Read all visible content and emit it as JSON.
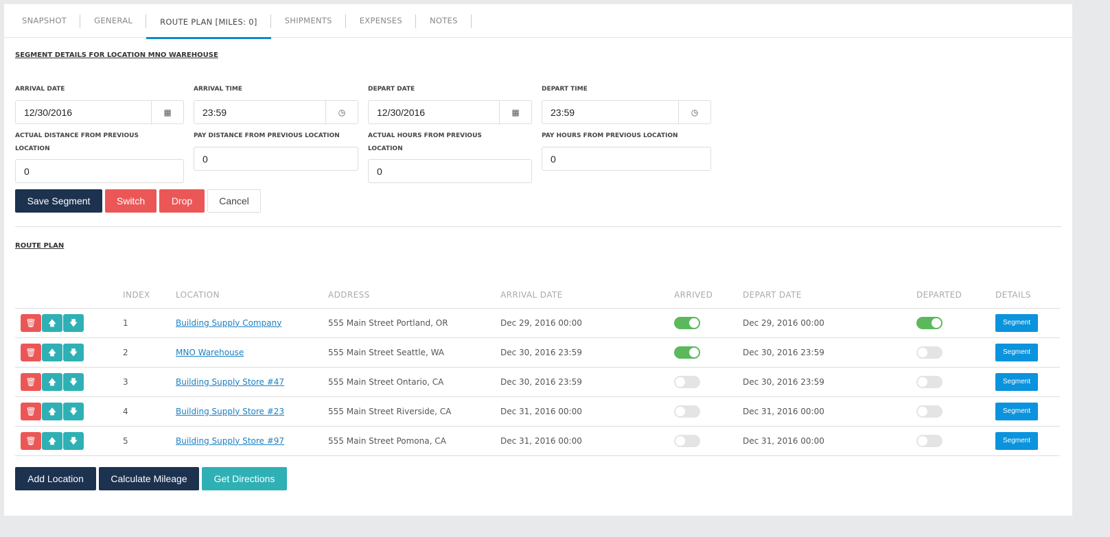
{
  "tabs": [
    "SNAPSHOT",
    "GENERAL",
    "ROUTE PLAN [MILES: 0]",
    "SHIPMENTS",
    "EXPENSES",
    "NOTES"
  ],
  "segment": {
    "heading": "SEGMENT DETAILS FOR LOCATION MNO WAREHOUSE",
    "arrival_date_label": "ARRIVAL DATE",
    "arrival_date": "12/30/2016",
    "arrival_time_label": "ARRIVAL TIME",
    "arrival_time": "23:59",
    "depart_date_label": "DEPART DATE",
    "depart_date": "12/30/2016",
    "depart_time_label": "DEPART TIME",
    "depart_time": "23:59",
    "actual_distance_label": "ACTUAL DISTANCE FROM PREVIOUS LOCATION",
    "actual_distance": "0",
    "pay_distance_label": "PAY DISTANCE FROM PREVIOUS LOCATION",
    "pay_distance": "0",
    "actual_hours_label": "ACTUAL HOURS FROM PREVIOUS LOCATION",
    "actual_hours": "0",
    "pay_hours_label": "PAY HOURS FROM PREVIOUS LOCATION",
    "pay_hours": "0",
    "save": "Save Segment",
    "switch": "Switch",
    "drop": "Drop",
    "cancel": "Cancel"
  },
  "route": {
    "heading": "ROUTE PLAN",
    "columns": [
      "INDEX",
      "LOCATION",
      "ADDRESS",
      "ARRIVAL DATE",
      "ARRIVED",
      "DEPART DATE",
      "DEPARTED",
      "DETAILS"
    ],
    "rows": [
      {
        "index": "1",
        "location": "Building Supply Company",
        "address": "555 Main Street Portland, OR",
        "arrival": "Dec 29, 2016 00:00",
        "arrived": true,
        "depart": "Dec 29, 2016 00:00",
        "departed": true,
        "details": "Segment"
      },
      {
        "index": "2",
        "location": "MNO Warehouse",
        "address": "555 Main Street Seattle, WA",
        "arrival": "Dec 30, 2016 23:59",
        "arrived": true,
        "depart": "Dec 30, 2016 23:59",
        "departed": false,
        "details": "Segment"
      },
      {
        "index": "3",
        "location": "Building Supply Store #47",
        "address": "555 Main Street Ontario, CA",
        "arrival": "Dec 30, 2016 23:59",
        "arrived": false,
        "depart": "Dec 30, 2016 23:59",
        "departed": false,
        "details": "Segment"
      },
      {
        "index": "4",
        "location": "Building Supply Store #23",
        "address": "555 Main Street Riverside, CA",
        "arrival": "Dec 31, 2016 00:00",
        "arrived": false,
        "depart": "Dec 31, 2016 00:00",
        "departed": false,
        "details": "Segment"
      },
      {
        "index": "5",
        "location": "Building Supply Store #97",
        "address": "555 Main Street Pomona, CA",
        "arrival": "Dec 31, 2016 00:00",
        "arrived": false,
        "depart": "Dec 31, 2016 00:00",
        "departed": false,
        "details": "Segment"
      }
    ],
    "add": "Add Location",
    "calc": "Calculate Mileage",
    "directions": "Get Directions"
  }
}
